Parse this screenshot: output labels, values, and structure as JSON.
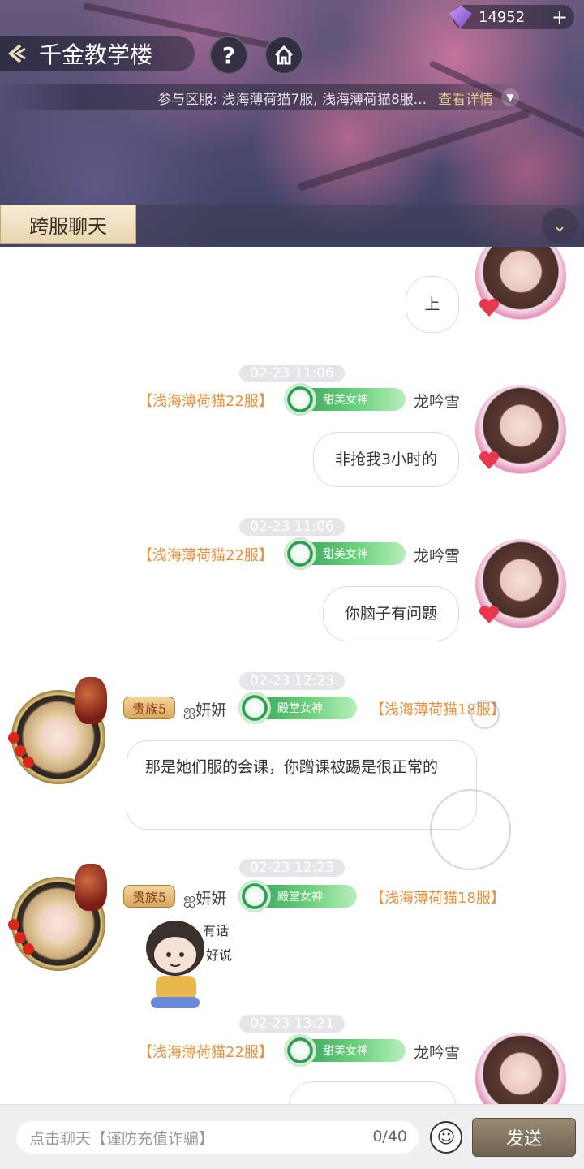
{
  "header": {
    "title": "千金教学楼",
    "currency_amount": "14952",
    "currency_plus": "+",
    "help_label": "?",
    "servers_text": "参与区服: 浅海薄荷猫7服, 浅海薄荷猫8服...",
    "details_label": "查看详情",
    "tab_label": "跨服聊天"
  },
  "messages": [
    {
      "side": "right",
      "text": "上"
    },
    {
      "side": "right",
      "time": "02-23 11:06",
      "server": "【浅海薄荷猫22服】",
      "badge": "甜美女神",
      "name": "龙吟雪",
      "text": "非抢我3小时的"
    },
    {
      "side": "right",
      "time": "02-23 11:06",
      "server": "【浅海薄荷猫22服】",
      "badge": "甜美女神",
      "name": "龙吟雪",
      "text": "你脑子有问题"
    },
    {
      "side": "left",
      "time": "02-23 12:23",
      "noble": "贵族5",
      "name": "ஐ妍妍",
      "badge": "殿堂女神",
      "server": "【浅海薄荷猫18服】",
      "text": "那是她们服的会课，你蹭课被踢是很正常的"
    },
    {
      "side": "left",
      "time": "02-23 12:23",
      "noble": "贵族5",
      "name": "ஐ妍妍",
      "badge": "殿堂女神",
      "server": "【浅海薄荷猫18服】",
      "sticker_text": "有话好说"
    },
    {
      "side": "right",
      "time": "02-23 13:21",
      "server": "【浅海薄荷猫22服】",
      "badge": "甜美女神",
      "name": "龙吟雪"
    }
  ],
  "input": {
    "placeholder": "点击聊天【谨防充值诈骗】",
    "counter": "0/40",
    "send_label": "发送"
  },
  "icons": {
    "back": "back-arrow-icon",
    "help": "question-icon",
    "home": "home-icon",
    "gem": "gem-icon",
    "collapse": "chevron-down-icon",
    "emoji": "smiley-icon"
  },
  "colors": {
    "server_tag": "#e89040",
    "title_badge": "#2f9a54",
    "send_button": "#6e6250",
    "tab_bg": "#f6ecd6"
  }
}
